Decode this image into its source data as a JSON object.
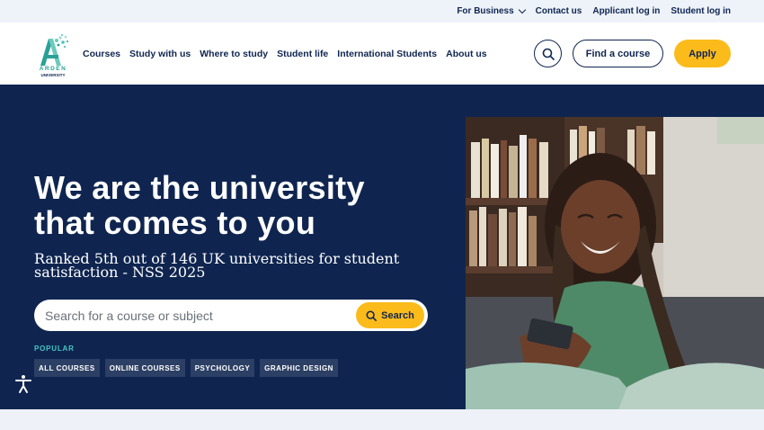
{
  "topbar": {
    "links": [
      {
        "label": "For Business",
        "has_dropdown": true
      },
      {
        "label": "Contact us"
      },
      {
        "label": "Applicant log in"
      },
      {
        "label": "Student log in"
      }
    ]
  },
  "logo": {
    "line1": "ARDEN",
    "line2": "UNIVERSITY",
    "color": "#2aa197"
  },
  "nav": {
    "items": [
      "Courses",
      "Study with us",
      "Where to study",
      "Student life",
      "International Students",
      "About us"
    ],
    "search_icon": "search-icon",
    "find_course_label": "Find a course",
    "apply_label": "Apply"
  },
  "hero": {
    "headline": "We are the university that comes to you",
    "subheadline": "Ranked 5th out of 146 UK universities for student satisfaction - NSS 2025",
    "search": {
      "placeholder": "Search for a course or subject",
      "button_label": "Search"
    },
    "popular_label": "POPULAR",
    "tags": [
      "ALL COURSES",
      "ONLINE COURSES",
      "PSYCHOLOGY",
      "GRAPHIC DESIGN"
    ]
  },
  "colors": {
    "navy": "#0f2550",
    "accent_yellow": "#fbbb1a",
    "teal": "#45c7c5",
    "background": "#eef2f8"
  }
}
